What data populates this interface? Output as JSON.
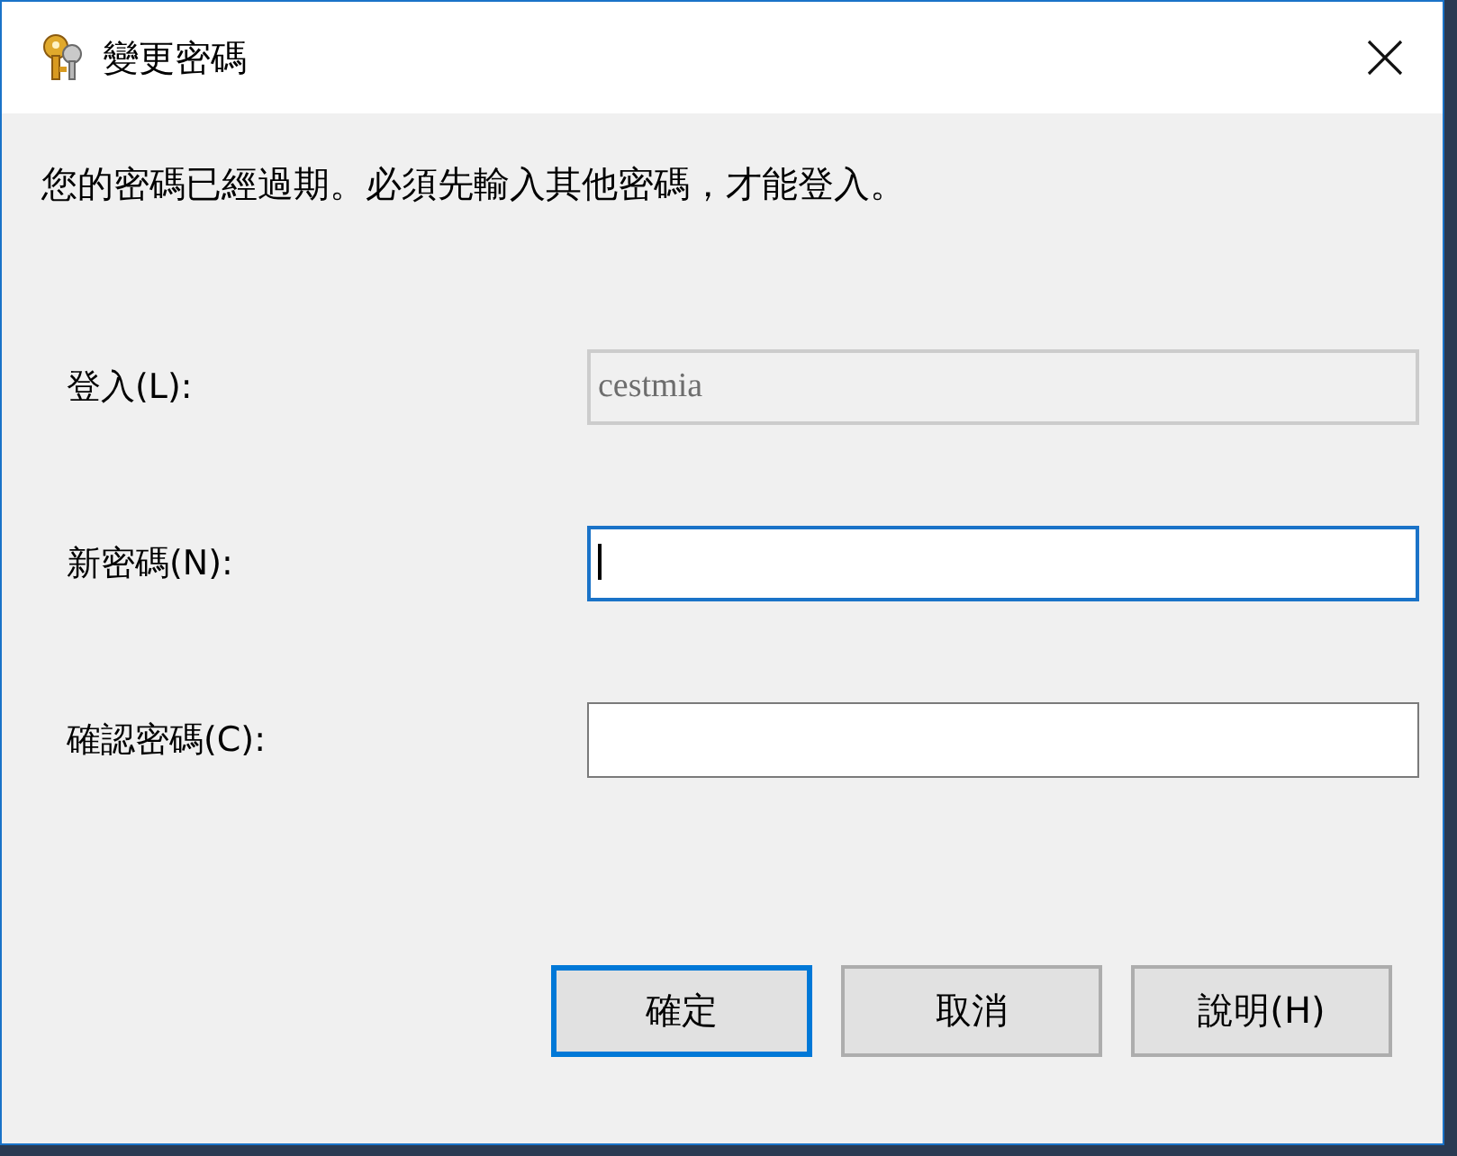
{
  "window": {
    "title": "變更密碼"
  },
  "message": "您的密碼已經過期。必須先輸入其他密碼，才能登入。",
  "fields": [
    {
      "label": "登入(L):",
      "value": "cestmia",
      "disabled": true,
      "focused": false
    },
    {
      "label": "新密碼(N):",
      "disabled": false,
      "focused": true
    },
    {
      "label": "確認密碼(C):",
      "disabled": false,
      "focused": false
    }
  ],
  "buttons": [
    {
      "label": "確定",
      "default": true
    },
    {
      "label": "取消",
      "default": false
    },
    {
      "label": "說明(H)",
      "default": false
    }
  ]
}
